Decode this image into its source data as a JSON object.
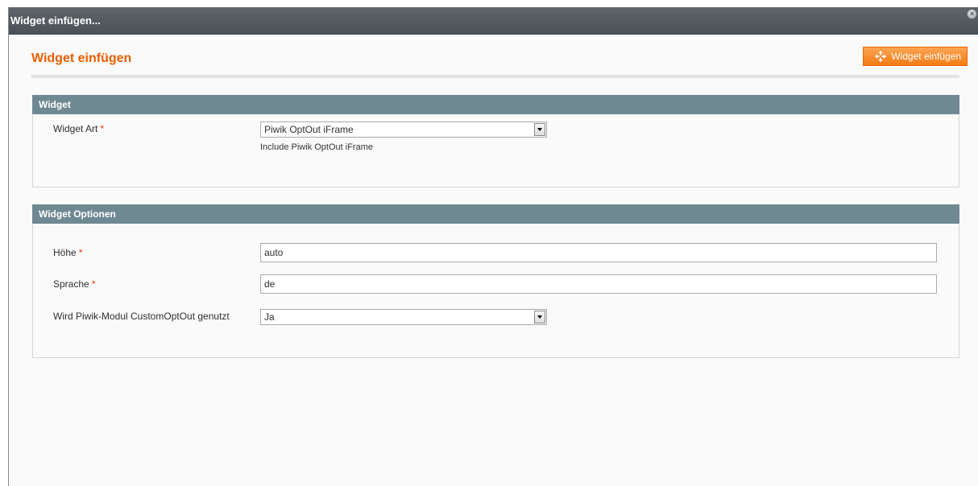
{
  "dialog": {
    "title": "Widget einfügen...",
    "close_icon": "close-icon"
  },
  "page": {
    "title": "Widget einfügen",
    "insert_button_label": "Widget einfügen",
    "insert_button_icon": "move-arrows-icon"
  },
  "widget_section": {
    "title": "Widget",
    "type_label": "Widget Art",
    "required_mark": "*",
    "type_value": "Piwik OptOut iFrame",
    "type_note": "Include Piwik OptOut iFrame"
  },
  "options_section": {
    "title": "Widget Optionen",
    "height_label": "Höhe",
    "height_value": "auto",
    "language_label": "Sprache",
    "language_value": "de",
    "custom_label": "Wird Piwik-Modul CustomOptOut genutzt",
    "custom_value": "Ja",
    "required_mark": "*"
  },
  "colors": {
    "accent": "#eb5e00",
    "button": "#f37b14",
    "section_header": "#6f8992",
    "titlebar": "#4b5257"
  }
}
